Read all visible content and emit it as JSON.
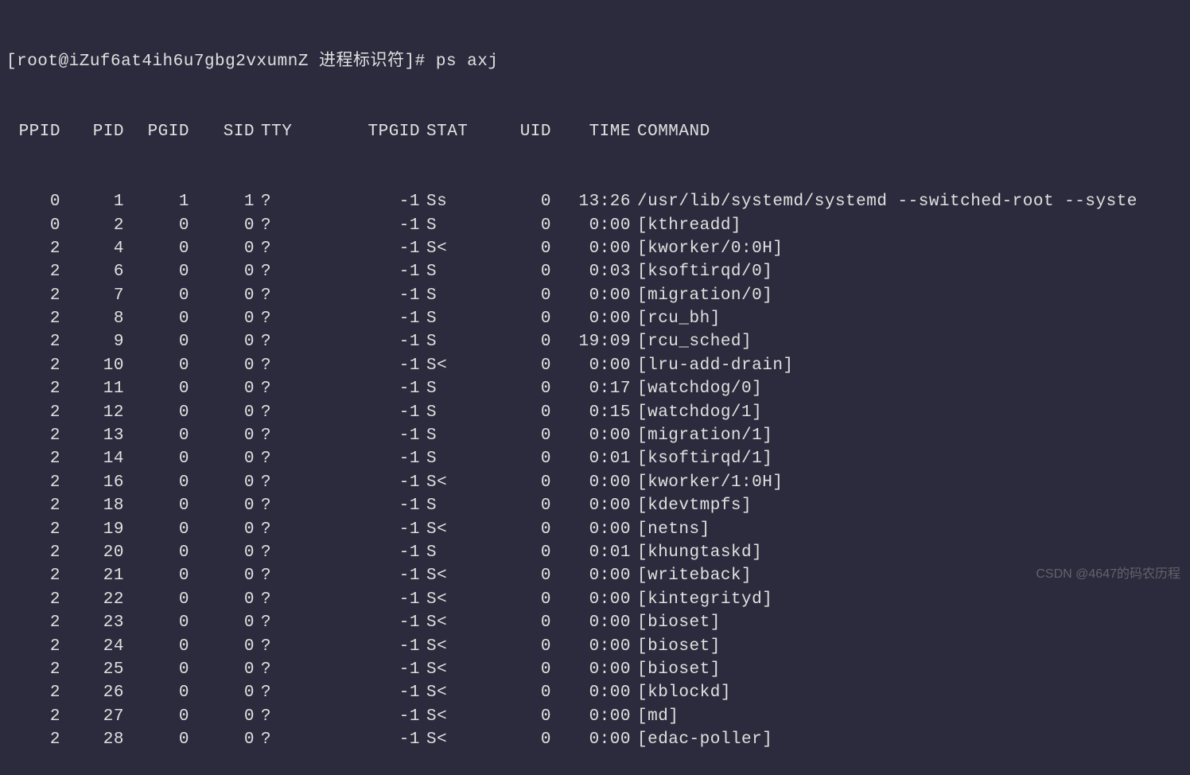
{
  "prompt": "[root@iZuf6at4ih6u7gbg2vxumnZ 进程标识符]# ps axj",
  "headers": {
    "ppid": "PPID",
    "pid": "PID",
    "pgid": "PGID",
    "sid": "SID",
    "tty": "TTY",
    "tpgid": "TPGID",
    "stat": "STAT",
    "uid": "UID",
    "time": "TIME",
    "command": "COMMAND"
  },
  "rows": [
    {
      "ppid": "0",
      "pid": "1",
      "pgid": "1",
      "sid": "1",
      "tty": "?",
      "tpgid": "-1",
      "stat": "Ss",
      "uid": "0",
      "time": "13:26",
      "command": "/usr/lib/systemd/systemd --switched-root --syste"
    },
    {
      "ppid": "0",
      "pid": "2",
      "pgid": "0",
      "sid": "0",
      "tty": "?",
      "tpgid": "-1",
      "stat": "S",
      "uid": "0",
      "time": "0:00",
      "command": "[kthreadd]"
    },
    {
      "ppid": "2",
      "pid": "4",
      "pgid": "0",
      "sid": "0",
      "tty": "?",
      "tpgid": "-1",
      "stat": "S<",
      "uid": "0",
      "time": "0:00",
      "command": "[kworker/0:0H]"
    },
    {
      "ppid": "2",
      "pid": "6",
      "pgid": "0",
      "sid": "0",
      "tty": "?",
      "tpgid": "-1",
      "stat": "S",
      "uid": "0",
      "time": "0:03",
      "command": "[ksoftirqd/0]"
    },
    {
      "ppid": "2",
      "pid": "7",
      "pgid": "0",
      "sid": "0",
      "tty": "?",
      "tpgid": "-1",
      "stat": "S",
      "uid": "0",
      "time": "0:00",
      "command": "[migration/0]"
    },
    {
      "ppid": "2",
      "pid": "8",
      "pgid": "0",
      "sid": "0",
      "tty": "?",
      "tpgid": "-1",
      "stat": "S",
      "uid": "0",
      "time": "0:00",
      "command": "[rcu_bh]"
    },
    {
      "ppid": "2",
      "pid": "9",
      "pgid": "0",
      "sid": "0",
      "tty": "?",
      "tpgid": "-1",
      "stat": "S",
      "uid": "0",
      "time": "19:09",
      "command": "[rcu_sched]"
    },
    {
      "ppid": "2",
      "pid": "10",
      "pgid": "0",
      "sid": "0",
      "tty": "?",
      "tpgid": "-1",
      "stat": "S<",
      "uid": "0",
      "time": "0:00",
      "command": "[lru-add-drain]"
    },
    {
      "ppid": "2",
      "pid": "11",
      "pgid": "0",
      "sid": "0",
      "tty": "?",
      "tpgid": "-1",
      "stat": "S",
      "uid": "0",
      "time": "0:17",
      "command": "[watchdog/0]"
    },
    {
      "ppid": "2",
      "pid": "12",
      "pgid": "0",
      "sid": "0",
      "tty": "?",
      "tpgid": "-1",
      "stat": "S",
      "uid": "0",
      "time": "0:15",
      "command": "[watchdog/1]"
    },
    {
      "ppid": "2",
      "pid": "13",
      "pgid": "0",
      "sid": "0",
      "tty": "?",
      "tpgid": "-1",
      "stat": "S",
      "uid": "0",
      "time": "0:00",
      "command": "[migration/1]"
    },
    {
      "ppid": "2",
      "pid": "14",
      "pgid": "0",
      "sid": "0",
      "tty": "?",
      "tpgid": "-1",
      "stat": "S",
      "uid": "0",
      "time": "0:01",
      "command": "[ksoftirqd/1]"
    },
    {
      "ppid": "2",
      "pid": "16",
      "pgid": "0",
      "sid": "0",
      "tty": "?",
      "tpgid": "-1",
      "stat": "S<",
      "uid": "0",
      "time": "0:00",
      "command": "[kworker/1:0H]"
    },
    {
      "ppid": "2",
      "pid": "18",
      "pgid": "0",
      "sid": "0",
      "tty": "?",
      "tpgid": "-1",
      "stat": "S",
      "uid": "0",
      "time": "0:00",
      "command": "[kdevtmpfs]"
    },
    {
      "ppid": "2",
      "pid": "19",
      "pgid": "0",
      "sid": "0",
      "tty": "?",
      "tpgid": "-1",
      "stat": "S<",
      "uid": "0",
      "time": "0:00",
      "command": "[netns]"
    },
    {
      "ppid": "2",
      "pid": "20",
      "pgid": "0",
      "sid": "0",
      "tty": "?",
      "tpgid": "-1",
      "stat": "S",
      "uid": "0",
      "time": "0:01",
      "command": "[khungtaskd]"
    },
    {
      "ppid": "2",
      "pid": "21",
      "pgid": "0",
      "sid": "0",
      "tty": "?",
      "tpgid": "-1",
      "stat": "S<",
      "uid": "0",
      "time": "0:00",
      "command": "[writeback]"
    },
    {
      "ppid": "2",
      "pid": "22",
      "pgid": "0",
      "sid": "0",
      "tty": "?",
      "tpgid": "-1",
      "stat": "S<",
      "uid": "0",
      "time": "0:00",
      "command": "[kintegrityd]"
    },
    {
      "ppid": "2",
      "pid": "23",
      "pgid": "0",
      "sid": "0",
      "tty": "?",
      "tpgid": "-1",
      "stat": "S<",
      "uid": "0",
      "time": "0:00",
      "command": "[bioset]"
    },
    {
      "ppid": "2",
      "pid": "24",
      "pgid": "0",
      "sid": "0",
      "tty": "?",
      "tpgid": "-1",
      "stat": "S<",
      "uid": "0",
      "time": "0:00",
      "command": "[bioset]"
    },
    {
      "ppid": "2",
      "pid": "25",
      "pgid": "0",
      "sid": "0",
      "tty": "?",
      "tpgid": "-1",
      "stat": "S<",
      "uid": "0",
      "time": "0:00",
      "command": "[bioset]"
    },
    {
      "ppid": "2",
      "pid": "26",
      "pgid": "0",
      "sid": "0",
      "tty": "?",
      "tpgid": "-1",
      "stat": "S<",
      "uid": "0",
      "time": "0:00",
      "command": "[kblockd]"
    },
    {
      "ppid": "2",
      "pid": "27",
      "pgid": "0",
      "sid": "0",
      "tty": "?",
      "tpgid": "-1",
      "stat": "S<",
      "uid": "0",
      "time": "0:00",
      "command": "[md]"
    },
    {
      "ppid": "2",
      "pid": "28",
      "pgid": "0",
      "sid": "0",
      "tty": "?",
      "tpgid": "-1",
      "stat": "S<",
      "uid": "0",
      "time": "0:00",
      "command": "[edac-poller]"
    }
  ],
  "watermark": "CSDN @4647的码农历程"
}
